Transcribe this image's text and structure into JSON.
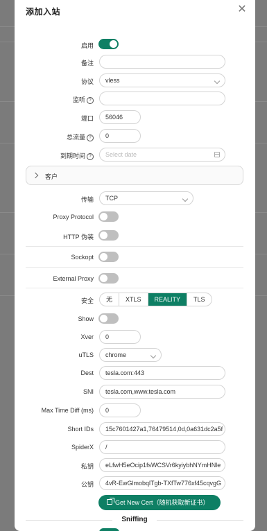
{
  "modal": {
    "title": "添加入站",
    "close_icon": "close-icon"
  },
  "fields": {
    "enable": {
      "label": "启用",
      "on": true
    },
    "remark": {
      "label": "备注",
      "value": ""
    },
    "protocol": {
      "label": "协议",
      "value": "vless"
    },
    "listen": {
      "label": "监听",
      "value": ""
    },
    "port": {
      "label": "端口",
      "value": "56046"
    },
    "total_traffic": {
      "label": "总流量",
      "value": "0"
    },
    "expiry": {
      "label": "到期时间",
      "placeholder": "Select date"
    }
  },
  "clients": {
    "label": "客户"
  },
  "transport": {
    "network": {
      "label": "传输",
      "value": "TCP"
    },
    "proxy_protocol": {
      "label": "Proxy Protocol",
      "on": false
    },
    "http_obfs": {
      "label": "HTTP 伪装",
      "on": false
    },
    "sockopt": {
      "label": "Sockopt",
      "on": false
    },
    "external_proxy": {
      "label": "External Proxy",
      "on": false
    }
  },
  "security": {
    "label": "安全",
    "options": [
      "无",
      "XTLS",
      "REALITY",
      "TLS"
    ],
    "selected": "REALITY"
  },
  "reality": {
    "show": {
      "label": "Show",
      "on": false
    },
    "xver": {
      "label": "Xver",
      "value": "0"
    },
    "utls": {
      "label": "uTLS",
      "value": "chrome"
    },
    "dest": {
      "label": "Dest",
      "value": "tesla.com:443"
    },
    "sni": {
      "label": "SNI",
      "value": "tesla.com,www.tesla.com"
    },
    "max_time_diff": {
      "label": "Max Time Diff (ms)",
      "value": "0"
    },
    "short_ids": {
      "label": "Short IDs",
      "value": "15c7601427a1,76479514,0d,0a631dc2a5f"
    },
    "spider_x": {
      "label": "SpiderX",
      "value": "/"
    },
    "private_key": {
      "label": "私钥",
      "value": "eLfwH5eOcip1fsWCSVr6kyiybhNYmHNle"
    },
    "public_key": {
      "label": "公钥",
      "value": "4vR-EwGlmobqlTgb-TXfTw776xf45cqvgG"
    },
    "get_cert_button": "Get New Cert（随机获取新证书）"
  },
  "sniffing": {
    "label": "Sniffing"
  },
  "colors": {
    "accent": "#0e7f64",
    "overlay": "#7b7b7b"
  }
}
